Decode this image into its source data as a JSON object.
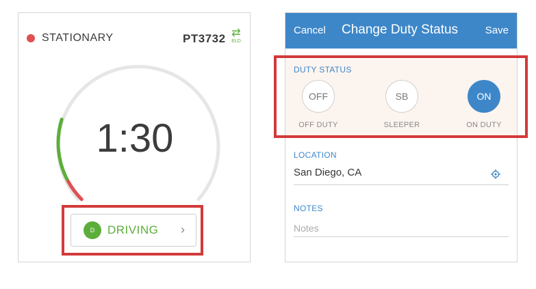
{
  "left": {
    "status_text": "STATIONARY",
    "truck_id": "PT3732",
    "eld_label": "ELD",
    "timer": "1:30",
    "driving_badge": "D",
    "driving_label": "DRIVING",
    "chevron": "›",
    "dial_progress": {
      "green_fraction": 0.17,
      "red_fraction": 0.06
    }
  },
  "right": {
    "cancel": "Cancel",
    "title": "Change Duty Status",
    "save": "Save",
    "duty_status_label": "DUTY STATUS",
    "options": [
      {
        "code": "OFF",
        "caption": "OFF DUTY",
        "active": false
      },
      {
        "code": "SB",
        "caption": "SLEEPER",
        "active": false
      },
      {
        "code": "ON",
        "caption": "ON DUTY",
        "active": true
      }
    ],
    "location_label": "LOCATION",
    "location_value": "San Diego, CA",
    "notes_label": "NOTES",
    "notes_placeholder": "Notes",
    "notes_value": ""
  },
  "colors": {
    "accent_blue": "#3d87c9",
    "driving_green": "#5cae3a",
    "alert_red": "#e05050",
    "highlight_red": "#d23a3a"
  },
  "icons": {
    "status": "status-dot-icon",
    "eld": "swap-arrows-icon",
    "chevron": "chevron-right-icon",
    "location": "gps-target-icon"
  }
}
